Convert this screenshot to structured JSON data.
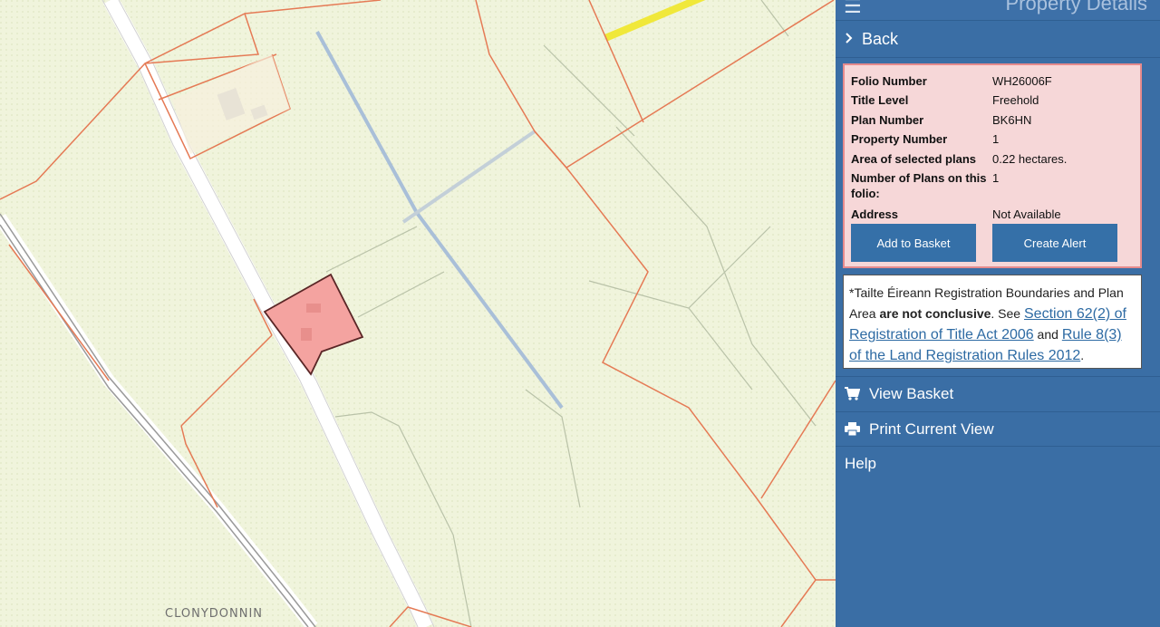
{
  "map": {
    "place_label": "CLONYDONNIN"
  },
  "panel": {
    "title": "Property Details",
    "back_label": "Back",
    "details": {
      "rows": [
        {
          "label": "Folio Number",
          "value": "WH26006F"
        },
        {
          "label": "Title Level",
          "value": "Freehold"
        },
        {
          "label": "Plan Number",
          "value": "BK6HN"
        },
        {
          "label": "Property Number",
          "value": "1"
        },
        {
          "label": "Area of selected plans",
          "value": "0.22 hectares."
        },
        {
          "label": "Number of Plans on this folio:",
          "value": "1"
        },
        {
          "label": "Address",
          "value": "Not Available"
        }
      ],
      "add_to_basket_label": "Add to Basket",
      "create_alert_label": "Create Alert"
    },
    "notice": {
      "prefix": "*Tailte Éireann Registration Boundaries and Plan Area ",
      "bold": "are not conclusive",
      "mid": ". See ",
      "link1": "Section 62(2) of Registration of Title Act 2006",
      "and": " and ",
      "link2": "Rule 8(3) of the Land Registration Rules 2012",
      "suffix": "."
    },
    "menu": {
      "view_basket": "View Basket",
      "print_current_view": "Print Current View",
      "help": "Help"
    }
  },
  "colors": {
    "panel_bg": "#3a6ea5",
    "details_bg": "#f6d7d8",
    "details_border": "#e58a8c",
    "selected_parcel": "#f4a3a0",
    "boundary": "#e57a55",
    "map_bg": "#f0f4dc"
  }
}
